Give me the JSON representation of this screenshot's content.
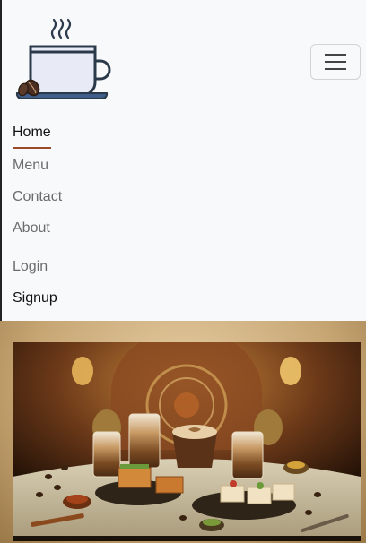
{
  "nav": {
    "brand": "coffee-cup-logo",
    "toggle_icon": "hamburger-menu-icon",
    "items": [
      {
        "label": "Home",
        "active": true
      },
      {
        "label": "Menu",
        "active": false
      },
      {
        "label": "Contact",
        "active": false
      },
      {
        "label": "About",
        "active": false
      }
    ],
    "auth": [
      {
        "label": "Login"
      },
      {
        "label": "Signup"
      }
    ]
  },
  "colors": {
    "navbar_bg": "#f8f9fa",
    "active_underline": "#9a4a2a",
    "cup_fill": "#e8eaf6",
    "cup_stroke": "#2b3a4a"
  },
  "hero": {
    "image": "coffee-and-dessert-spread-image"
  }
}
